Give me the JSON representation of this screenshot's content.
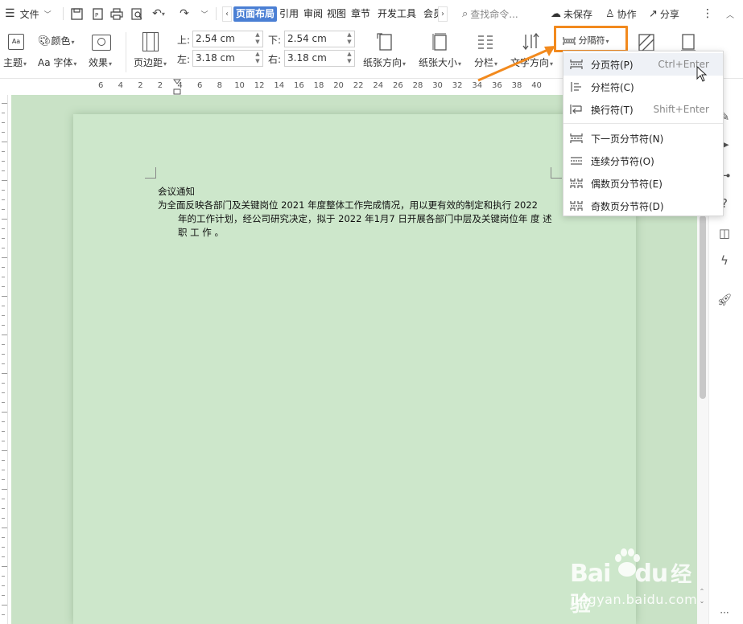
{
  "topbar": {
    "menu_label": "文件",
    "tabs": [
      {
        "label": "页面布局",
        "active": true
      },
      {
        "label": "引用",
        "active": false
      },
      {
        "label": "审阅",
        "active": false
      },
      {
        "label": "视图",
        "active": false
      },
      {
        "label": "章节",
        "active": false
      },
      {
        "label": "开发工具",
        "active": false
      },
      {
        "label": "会员",
        "active": false
      }
    ],
    "search_placeholder": "查找命令...",
    "unsaved_label": "未保存",
    "collab_label": "协作",
    "share_label": "分享"
  },
  "ribbon": {
    "theme_label": "主题",
    "color_label": "颜色",
    "font_label": "字体",
    "effect_label": "效果",
    "margins_label": "页边距",
    "top_label": "上:",
    "top_value": "2.54 cm",
    "bottom_label": "下:",
    "bottom_value": "2.54 cm",
    "left_label": "左:",
    "left_value": "3.18 cm",
    "right_label": "右:",
    "right_value": "3.18 cm",
    "orientation_label": "纸张方向",
    "size_label": "纸张大小",
    "columns_label": "分栏",
    "text_dir_label": "文字方向",
    "break_label": "分隔符"
  },
  "ruler": {
    "ticks": [
      "6",
      "4",
      "2",
      "2",
      "4",
      "6",
      "8",
      "10",
      "12",
      "14",
      "16",
      "18",
      "20",
      "22",
      "24",
      "26",
      "28",
      "30",
      "32",
      "34",
      "36",
      "38",
      "40"
    ]
  },
  "document": {
    "title": "会议通知",
    "line1": "为全面反映各部门及关键岗位 2021 年度整体工作完成情况，用以更有效的制定和执行 2022",
    "line2": "年的工作计划，经公司研究决定，拟于 2022 年1月7 日开展各部门中层及关键岗位年 度 述",
    "line3": "职 工 作 。"
  },
  "dropdown": {
    "items": [
      {
        "label": "分页符(P)",
        "shortcut": "Ctrl+Enter"
      },
      {
        "label": "分栏符(C)",
        "shortcut": ""
      },
      {
        "label": "换行符(T)",
        "shortcut": "Shift+Enter"
      },
      {
        "label": "下一页分节符(N)",
        "shortcut": ""
      },
      {
        "label": "连续分节符(O)",
        "shortcut": ""
      },
      {
        "label": "偶数页分节符(E)",
        "shortcut": ""
      },
      {
        "label": "奇数页分节符(D)",
        "shortcut": ""
      }
    ]
  },
  "watermark": {
    "brand": "Bai",
    "brand2": "du",
    "suffix": "经验",
    "url": "jingyan.baidu.com"
  },
  "colors": {
    "accent": "#4a7fd4",
    "highlight": "#f28a1e",
    "page_bg": "#cde7cb"
  }
}
